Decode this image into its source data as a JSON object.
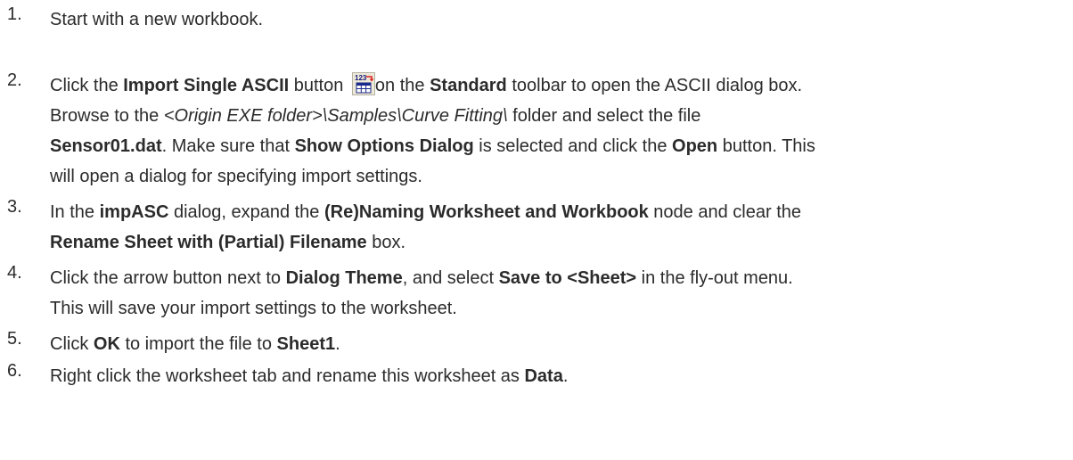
{
  "steps": [
    {
      "number": "1.",
      "lines": [
        [
          {
            "t": "Start with a new workbook.",
            "s": ""
          }
        ]
      ]
    },
    {
      "number": "2.",
      "lines": [
        [
          {
            "t": "Click the ",
            "s": ""
          },
          {
            "t": "Import Single ASCII",
            "s": "b"
          },
          {
            "t": " button ",
            "s": ""
          },
          {
            "icon": "import-single-ascii-icon"
          },
          {
            "t": "on the ",
            "s": ""
          },
          {
            "t": "Standard",
            "s": "b"
          },
          {
            "t": " toolbar to open the ASCII dialog box.",
            "s": ""
          }
        ],
        [
          {
            "t": "Browse to the ",
            "s": ""
          },
          {
            "t": "<Origin EXE folder>\\Samples\\Curve Fitting\\",
            "s": "i"
          },
          {
            "t": " folder and select the file",
            "s": ""
          }
        ],
        [
          {
            "t": "Sensor01.dat",
            "s": "b"
          },
          {
            "t": ". Make sure that ",
            "s": ""
          },
          {
            "t": "Show Options Dialog",
            "s": "b"
          },
          {
            "t": " is selected and click the ",
            "s": ""
          },
          {
            "t": "Open",
            "s": "b"
          },
          {
            "t": " button. This",
            "s": ""
          }
        ],
        [
          {
            "t": "will open a dialog for specifying import settings.",
            "s": ""
          }
        ]
      ]
    },
    {
      "number": "3.",
      "lines": [
        [
          {
            "t": "In the ",
            "s": ""
          },
          {
            "t": "impASC",
            "s": "b"
          },
          {
            "t": " dialog, expand the ",
            "s": ""
          },
          {
            "t": "(Re)Naming Worksheet and Workbook",
            "s": "b"
          },
          {
            "t": " node and clear the",
            "s": ""
          }
        ],
        [
          {
            "t": "Rename Sheet with (Partial) Filename",
            "s": "b"
          },
          {
            "t": " box.",
            "s": ""
          }
        ]
      ]
    },
    {
      "number": "4.",
      "lines": [
        [
          {
            "t": "Click the arrow button next to ",
            "s": ""
          },
          {
            "t": "Dialog Theme",
            "s": "b"
          },
          {
            "t": ", and select ",
            "s": ""
          },
          {
            "t": "Save to <Sheet>",
            "s": "b"
          },
          {
            "t": " in the fly-out menu.",
            "s": ""
          }
        ],
        [
          {
            "t": "This will save your import settings to the worksheet.",
            "s": ""
          }
        ]
      ]
    },
    {
      "number": "5.",
      "lines": [
        [
          {
            "t": "Click ",
            "s": ""
          },
          {
            "t": "OK",
            "s": "b"
          },
          {
            "t": " to import the file to ",
            "s": ""
          },
          {
            "t": "Sheet1",
            "s": "b"
          },
          {
            "t": ".",
            "s": ""
          }
        ]
      ]
    },
    {
      "number": "6.",
      "lines": [
        [
          {
            "t": "Right click the worksheet tab and rename this worksheet as ",
            "s": ""
          },
          {
            "t": "Data",
            "s": "b"
          },
          {
            "t": ".",
            "s": ""
          }
        ]
      ]
    }
  ]
}
